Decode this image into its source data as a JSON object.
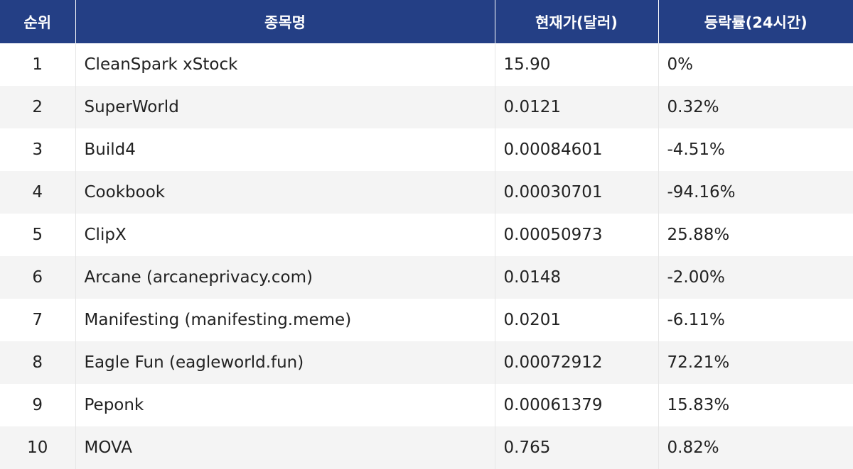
{
  "table": {
    "headers": {
      "rank": "순위",
      "name": "종목명",
      "price": "현재가(달러)",
      "change": "등락률(24시간)"
    },
    "rows": [
      {
        "rank": "1",
        "name": "CleanSpark xStock",
        "price": "15.90",
        "change": "0%"
      },
      {
        "rank": "2",
        "name": "SuperWorld",
        "price": "0.0121",
        "change": "0.32%"
      },
      {
        "rank": "3",
        "name": "Build4",
        "price": "0.00084601",
        "change": "-4.51%"
      },
      {
        "rank": "4",
        "name": "Cookbook",
        "price": "0.00030701",
        "change": "-94.16%"
      },
      {
        "rank": "5",
        "name": "ClipX",
        "price": "0.00050973",
        "change": "25.88%"
      },
      {
        "rank": "6",
        "name": "Arcane (arcaneprivacy.com)",
        "price": "0.0148",
        "change": "-2.00%"
      },
      {
        "rank": "7",
        "name": "Manifesting (manifesting.meme)",
        "price": "0.0201",
        "change": "-6.11%"
      },
      {
        "rank": "8",
        "name": "Eagle Fun (eagleworld.fun)",
        "price": "0.00072912",
        "change": "72.21%"
      },
      {
        "rank": "9",
        "name": "Peponk",
        "price": "0.00061379",
        "change": "15.83%"
      },
      {
        "rank": "10",
        "name": "MOVA",
        "price": "0.765",
        "change": "0.82%"
      }
    ]
  },
  "colors": {
    "header_bg": "#243f85",
    "header_text": "#ffffff",
    "row_alt_bg": "#f4f4f4"
  }
}
